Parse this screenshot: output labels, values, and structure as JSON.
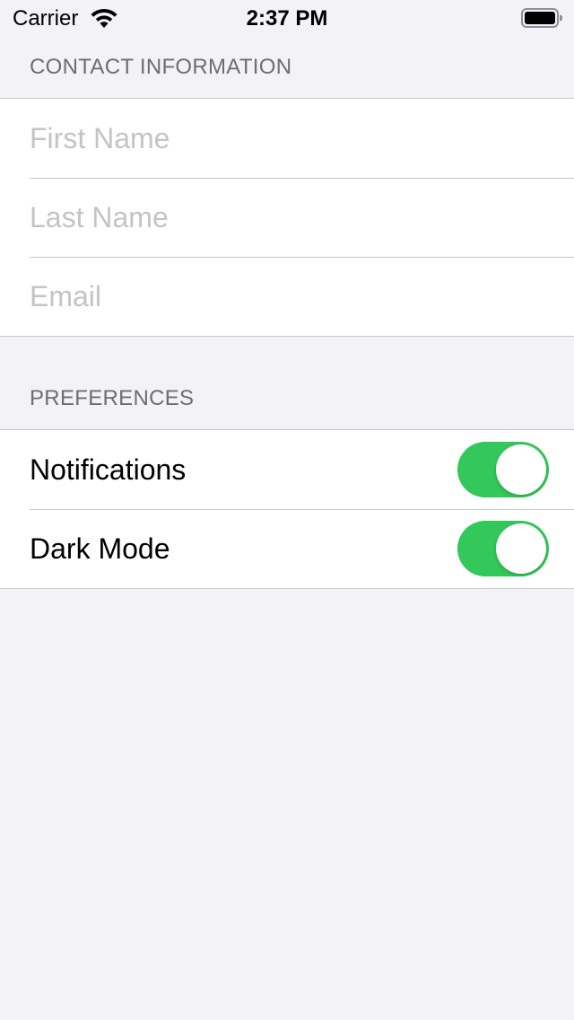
{
  "status_bar": {
    "carrier": "Carrier",
    "time": "2:37 PM",
    "wifi_icon": "wifi-icon",
    "battery_icon": "battery-icon"
  },
  "contact_section": {
    "header": "CONTACT INFORMATION",
    "fields": [
      {
        "placeholder": "First Name",
        "value": ""
      },
      {
        "placeholder": "Last Name",
        "value": ""
      },
      {
        "placeholder": "Email",
        "value": ""
      }
    ]
  },
  "preferences_section": {
    "header": "PREFERENCES",
    "items": [
      {
        "label": "Notifications",
        "enabled": true
      },
      {
        "label": "Dark Mode",
        "enabled": true
      }
    ]
  },
  "colors": {
    "background": "#f2f2f7",
    "toggle_on": "#34c759",
    "section_header": "#6d6d72",
    "placeholder": "#c4c4c6",
    "separator": "#c8c7cc"
  }
}
